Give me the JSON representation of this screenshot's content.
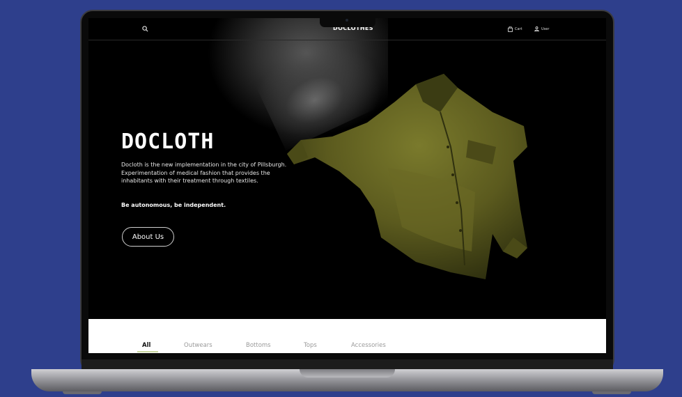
{
  "header": {
    "brand": "DOCLOTHES",
    "cart_label": "Cart",
    "user_label": "User",
    "icons": [
      "search-icon",
      "cart-icon",
      "user-icon"
    ]
  },
  "hero": {
    "title": "DOCLOTH",
    "description": "Docloth is the new implementation in the city of Pillsburgh. Experimentation of medical fashion that provides the inhabitants with their treatment through textiles.",
    "tagline": "Be autonomous, be independent.",
    "cta_label": "About Us",
    "jacket_color": "#5b5a1e"
  },
  "categories": {
    "tabs": [
      {
        "label": "All",
        "active": true
      },
      {
        "label": "Outwears",
        "active": false
      },
      {
        "label": "Bottoms",
        "active": false
      },
      {
        "label": "Tops",
        "active": false
      },
      {
        "label": "Accessories",
        "active": false
      }
    ],
    "active_color": "#c9d7a0"
  },
  "colors": {
    "background": "#2e3f8c",
    "screen": "#000000",
    "strip": "#ffffff"
  }
}
